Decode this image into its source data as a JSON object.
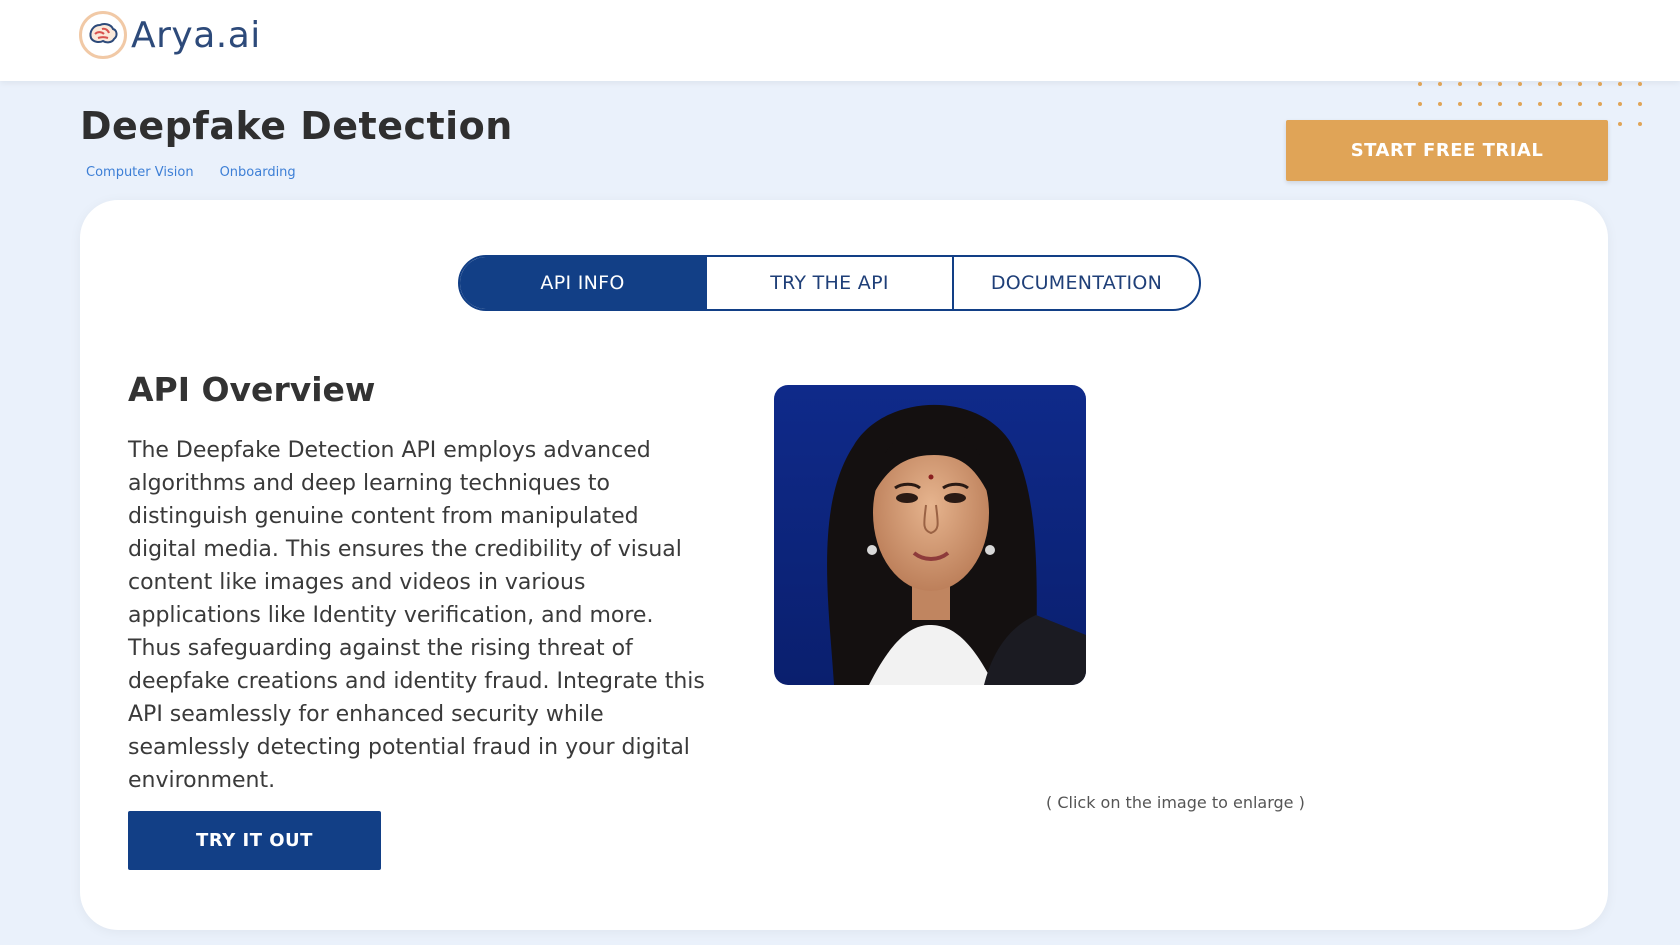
{
  "header": {
    "logo_text": "Arya.ai",
    "logo_icon": "brain-logo-icon"
  },
  "page": {
    "title": "Deepfake Detection",
    "tags": [
      "Computer Vision",
      "Onboarding"
    ],
    "cta_label": "START FREE TRIAL"
  },
  "tabs": [
    {
      "label": "API INFO",
      "active": true
    },
    {
      "label": "TRY THE API",
      "active": false
    },
    {
      "label": "DOCUMENTATION",
      "active": false
    }
  ],
  "overview": {
    "heading": "API Overview",
    "body": "The Deepfake Detection API employs advanced algorithms and deep learning techniques to distinguish genuine content from manipulated digital media. This ensures the credibility of visual content like images and videos in various applications like Identity verification, and more. Thus safeguarding against the rising threat of deepfake creations and identity fraud. Integrate this API seamlessly for enhanced security while seamlessly detecting potential fraud in your digital environment.",
    "button_label": "TRY IT OUT"
  },
  "image": {
    "caption": "( Click on the image to enlarge )"
  },
  "colors": {
    "primary": "#123f86",
    "accent": "#e0a457",
    "background": "#eaf1fb",
    "tag": "#3d7fd6"
  }
}
